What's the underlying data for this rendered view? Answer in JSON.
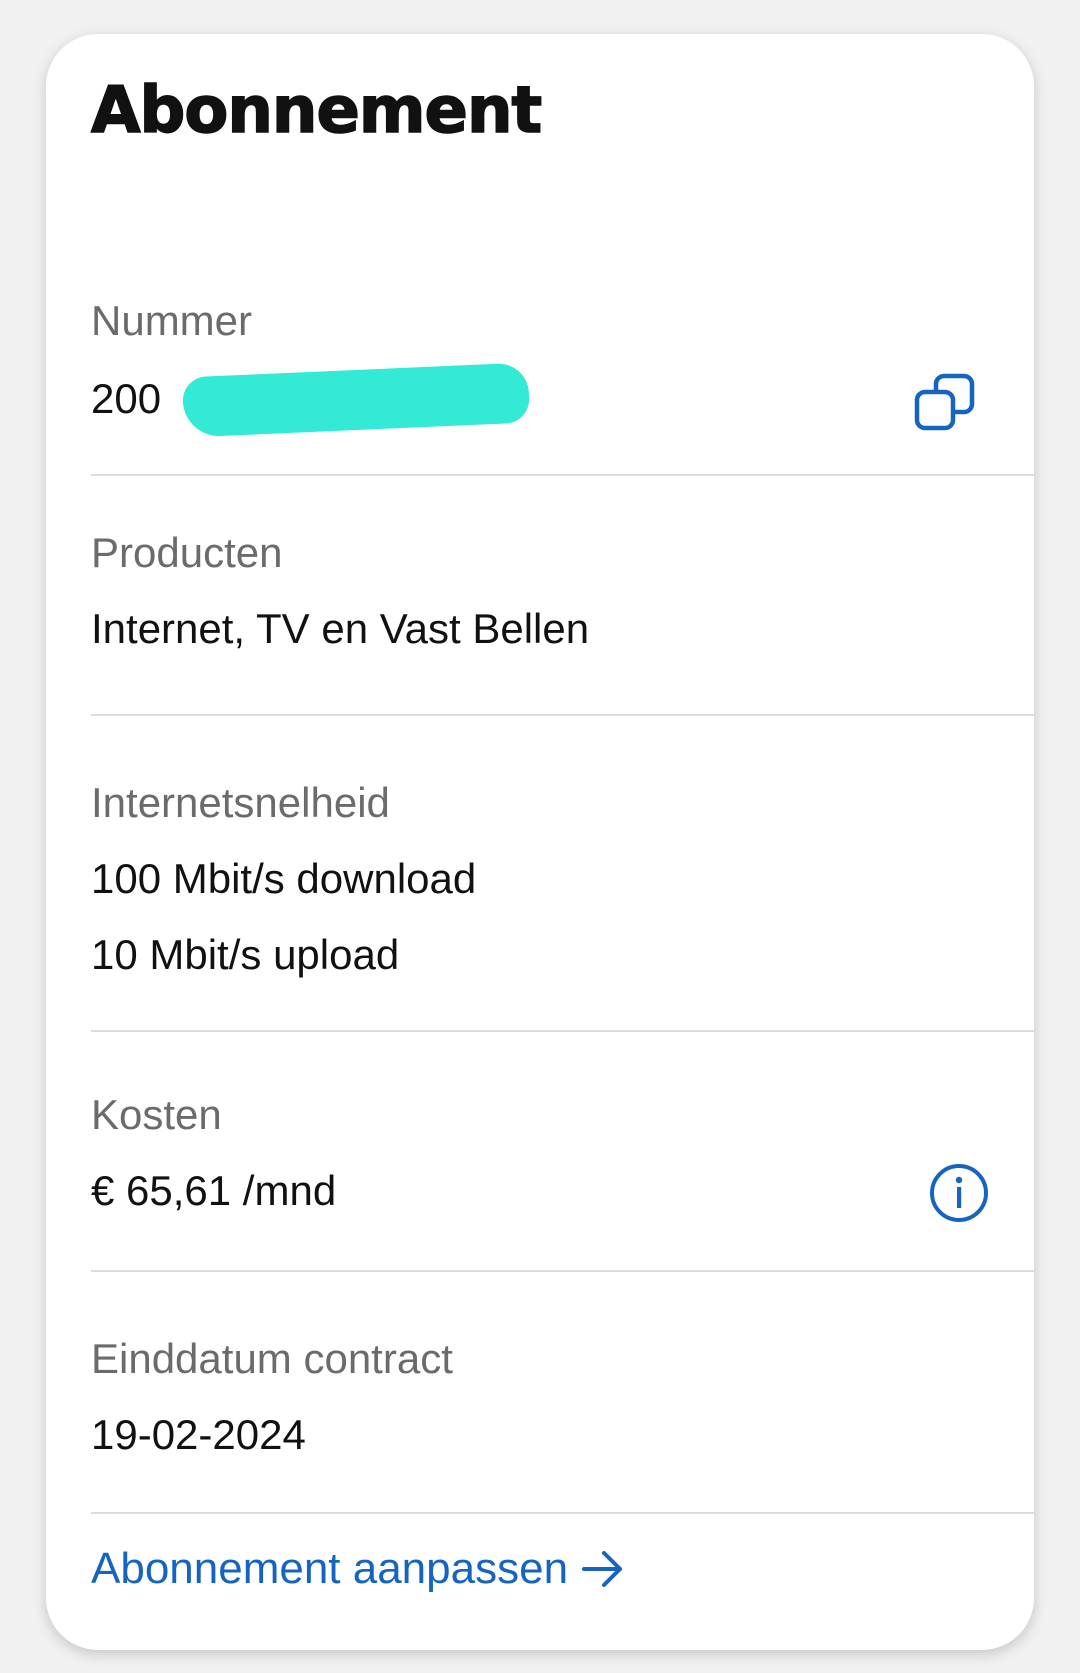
{
  "card": {
    "title": "Abonnement"
  },
  "number": {
    "label": "Nummer",
    "value_visible": "200",
    "icon": "copy-icon"
  },
  "products": {
    "label": "Producten",
    "value": "Internet, TV en Vast Bellen"
  },
  "speed": {
    "label": "Internetsnelheid",
    "download": "100 Mbit/s download",
    "upload": "10 Mbit/s upload"
  },
  "costs": {
    "label": "Kosten",
    "value": "€ 65,61 /mnd",
    "icon": "info-icon"
  },
  "contract": {
    "label": "Einddatum contract",
    "value": "19-02-2024"
  },
  "footer": {
    "link_label": "Abonnement aanpassen",
    "icon": "arrow-right-icon"
  },
  "colors": {
    "accent": "#1565c0",
    "redaction": "#33ead5",
    "label_gray": "#6b6b6b",
    "divider": "#dcdcdc"
  }
}
